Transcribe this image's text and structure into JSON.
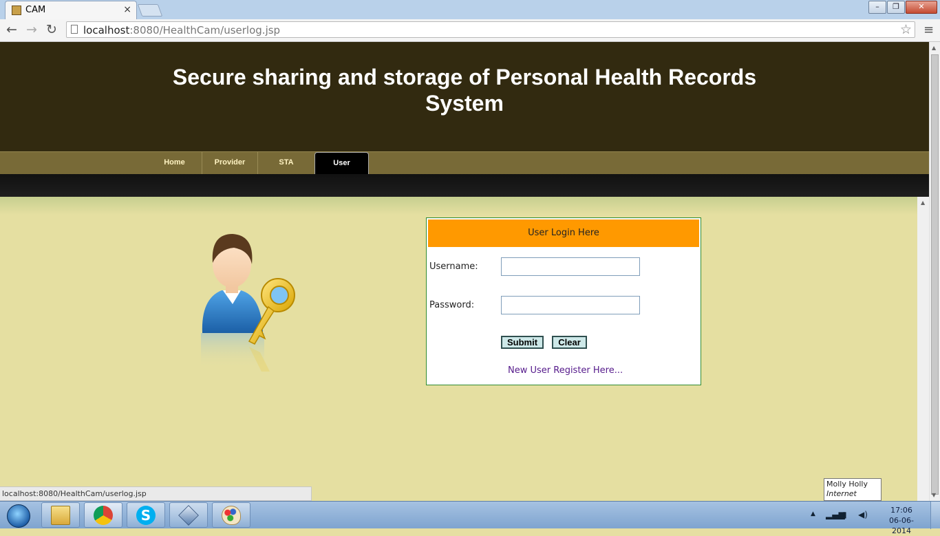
{
  "browser": {
    "tab_title": "CAM",
    "tab_close": "×",
    "url_host": "localhost",
    "url_rest": ":8080/HealthCam/userlog.jsp",
    "nav": {
      "back": "←",
      "forward": "→",
      "reload": "↻"
    },
    "star": "☆",
    "menu": "≡",
    "window_buttons": {
      "minimize": "–",
      "maximize": "❐",
      "close": "✕"
    }
  },
  "page": {
    "title_line1": "Secure sharing and storage of Personal Health Records",
    "title_line2": "System",
    "menu": [
      {
        "label": "Home"
      },
      {
        "label": "Provider"
      },
      {
        "label": "STA"
      },
      {
        "label": "User",
        "active": true
      }
    ]
  },
  "login": {
    "heading": "User Login Here",
    "username_label": "Username:",
    "username_value": "",
    "password_label": "Password:",
    "password_value": "",
    "submit_label": "Submit",
    "clear_label": "Clear",
    "register_link": "New User Register Here..."
  },
  "status_bar": "localhost:8080/HealthCam/userlog.jsp",
  "tooltip": {
    "line1": "Molly Holly",
    "line2": "Internet access"
  },
  "taskbar": {
    "apps": [
      "file-explorer-icon",
      "chrome-icon",
      "skype-icon",
      "virtualbox-icon",
      "paint-icon"
    ],
    "time": "17:06",
    "date": "06-06-2014"
  },
  "colors": {
    "header_bg": "#322a10",
    "menubar_bg": "#786a37",
    "content_bg": "#e5dfa1",
    "login_head_bg": "#ff9900",
    "login_border": "#2f8a2f"
  }
}
